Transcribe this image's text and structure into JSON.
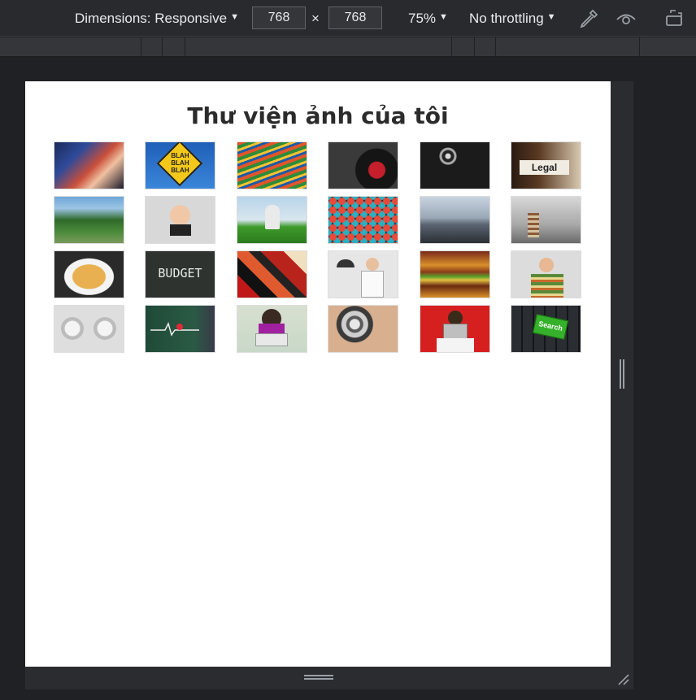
{
  "toolbar": {
    "dimensions_label": "Dimensions: Responsive",
    "width_value": "768",
    "times_sign": "×",
    "height_value": "768",
    "zoom_label": "75%",
    "throttling_label": "No throttling"
  },
  "page": {
    "title": "Thư viện ảnh của tôi"
  },
  "thumbnails": [
    {
      "name": "concert-crowd"
    },
    {
      "name": "blah-blah-sign",
      "text": "BLAH BLAH BLAH"
    },
    {
      "name": "colorful-lines"
    },
    {
      "name": "vintage-camera-records"
    },
    {
      "name": "monkey-spiral"
    },
    {
      "name": "legal-file-tab",
      "text": "Legal"
    },
    {
      "name": "bridge-landscape"
    },
    {
      "name": "boy-with-camera"
    },
    {
      "name": "man-in-grass-field"
    },
    {
      "name": "colorful-buttons"
    },
    {
      "name": "foggy-city-bridge"
    },
    {
      "name": "man-with-stack-of-books"
    },
    {
      "name": "pasta-dish"
    },
    {
      "name": "budget-chalkboard",
      "text": "BUDGET"
    },
    {
      "name": "red-abstract-window"
    },
    {
      "name": "businessman-umbrella-sketch"
    },
    {
      "name": "cheeseburger"
    },
    {
      "name": "man-with-paper-stack"
    },
    {
      "name": "oven-knobs"
    },
    {
      "name": "heartbeat-chalkboard"
    },
    {
      "name": "woman-with-laptop"
    },
    {
      "name": "safe-dial"
    },
    {
      "name": "woman-with-laptop-red-background"
    },
    {
      "name": "keyboard-search-key",
      "text": "Search"
    }
  ]
}
